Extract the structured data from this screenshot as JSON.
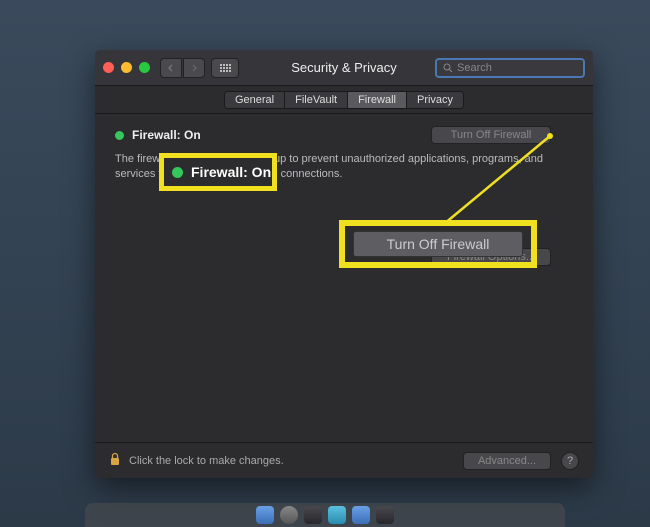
{
  "window": {
    "title": "Security & Privacy",
    "search_placeholder": "Search"
  },
  "tabs": {
    "general": "General",
    "filevault": "FileVault",
    "firewall": "Firewall",
    "privacy": "Privacy",
    "active": "Firewall"
  },
  "firewall": {
    "status_label": "Firewall: On",
    "description": "The firewall is turned on and set up to prevent unauthorized applications, programs, and services from accepting incoming connections.",
    "turn_off_label": "Turn Off Firewall",
    "options_label": "Firewall Options..."
  },
  "footer": {
    "lock_text": "Click the lock to make changes.",
    "advanced_label": "Advanced...",
    "help_label": "?"
  },
  "callout": {
    "status_text": "Firewall: On",
    "turn_off_text": "Turn Off Firewall"
  }
}
